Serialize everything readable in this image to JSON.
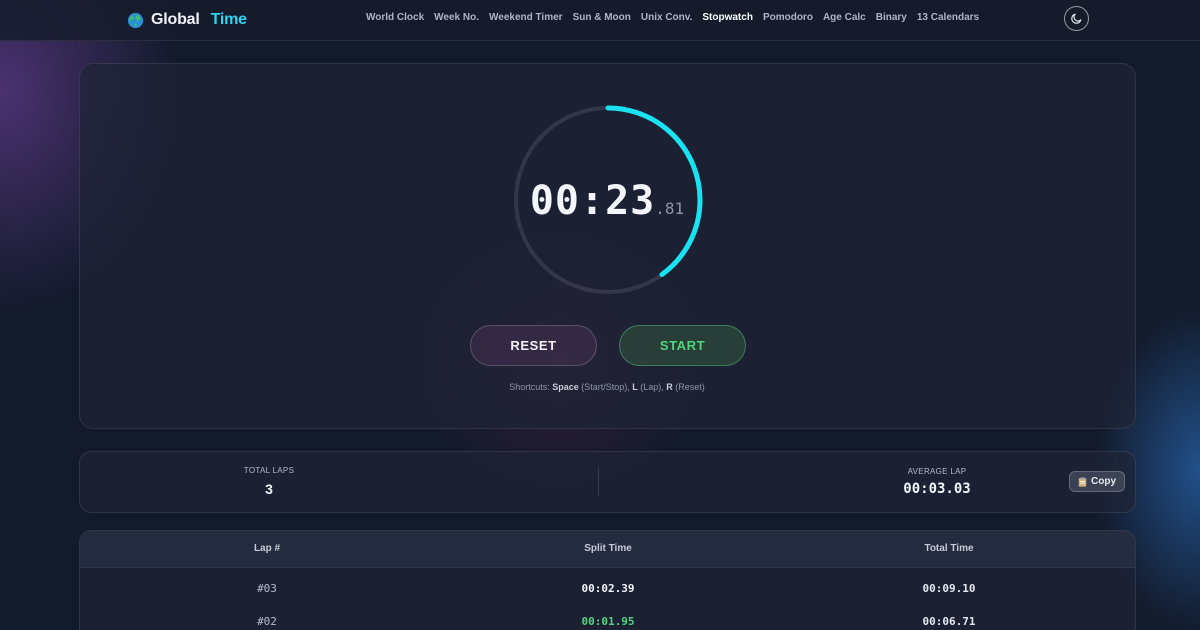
{
  "header": {
    "brand_part1": "Global",
    "brand_part2": "Time",
    "nav": [
      "World Clock",
      "Week No.",
      "Weekend Timer",
      "Sun & Moon",
      "Unix Conv.",
      "Stopwatch",
      "Pomodoro",
      "Age Calc",
      "Binary",
      "13 Calendars"
    ],
    "active_nav": "Stopwatch",
    "theme_icon": "moon-icon"
  },
  "stopwatch": {
    "time_main": "00:23",
    "time_ms": ".81",
    "progress": 0.4,
    "ring_color": "#19e3f2",
    "reset_label": "RESET",
    "start_label": "START",
    "shortcuts_prefix": "Shortcuts: ",
    "shortcut_space": "Space",
    "shortcut_space_desc": " (Start/Stop), ",
    "shortcut_lap": "L",
    "shortcut_lap_desc": " (Lap), ",
    "shortcut_reset": "R",
    "shortcut_reset_desc": " (Reset)"
  },
  "stats": {
    "total_laps_label": "TOTAL LAPS",
    "total_laps_value": "3",
    "average_lap_label": "AVERAGE LAP",
    "average_lap_value": "00:03.03",
    "copy_label": "Copy",
    "copy_icon": "clipboard-icon"
  },
  "laps": {
    "headers": [
      "Lap #",
      "Split Time",
      "Total Time"
    ],
    "rows": [
      {
        "lap": "#03",
        "split": "00:02.39",
        "total": "00:09.10"
      },
      {
        "lap": "#02",
        "split": "00:01.95",
        "total": "00:06.71"
      }
    ]
  },
  "colors": {
    "accent_cyan": "#2fd3f0",
    "start_green": "#52d37d",
    "background": "#131a2b"
  }
}
